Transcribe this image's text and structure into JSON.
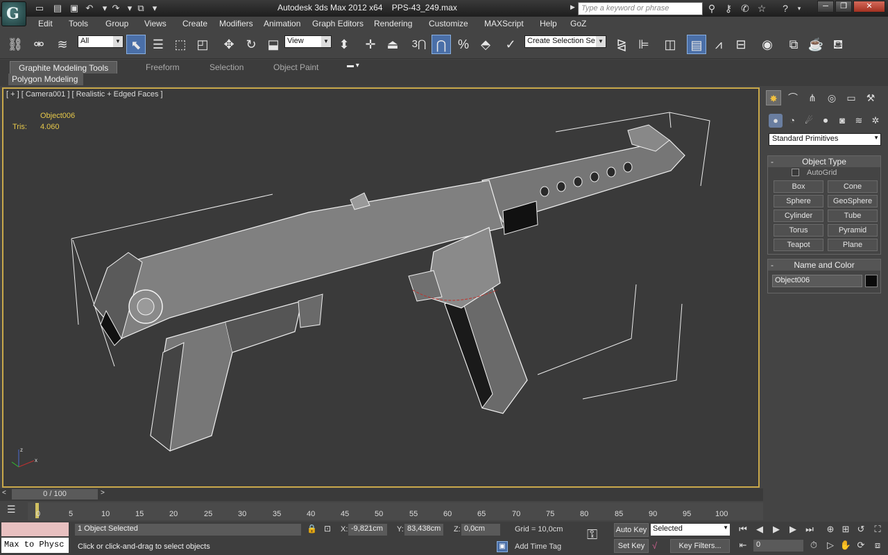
{
  "title": {
    "app": "Autodesk 3ds Max  2012 x64",
    "file": "PPS-43_249.max"
  },
  "search": {
    "placeholder": "Type a keyword or phrase"
  },
  "menu": [
    "Edit",
    "Tools",
    "Group",
    "Views",
    "Create",
    "Modifiers",
    "Animation",
    "Graph Editors",
    "Rendering",
    "Customize",
    "MAXScript",
    "Help",
    "GoZ"
  ],
  "toolbar": {
    "filter": "All",
    "refcoord": "View",
    "selection_set": "Create Selection Se",
    "snap_angle_label": "3"
  },
  "ribbon": {
    "tabs": [
      "Graphite Modeling Tools",
      "Freeform",
      "Selection",
      "Object Paint"
    ],
    "panel": "Polygon Modeling"
  },
  "viewport": {
    "label": "[ + ] [ Camera001 ] [ Realistic + Edged Faces ]",
    "stat_name": "Object006",
    "stat_key": "Tris:",
    "stat_value": "4.060"
  },
  "cmdpanel": {
    "category": "Standard Primitives",
    "object_type": "Object Type",
    "autogrid": "AutoGrid",
    "buttons": [
      "Box",
      "Cone",
      "Sphere",
      "GeoSphere",
      "Cylinder",
      "Tube",
      "Torus",
      "Pyramid",
      "Teapot",
      "Plane"
    ],
    "name_color": "Name and Color",
    "object_name": "Object006",
    "object_color": "#0a0a0a"
  },
  "timeline": {
    "frame": "0 / 100",
    "ticks": [
      "0",
      "5",
      "10",
      "15",
      "20",
      "25",
      "30",
      "35",
      "40",
      "45",
      "50",
      "55",
      "60",
      "65",
      "70",
      "75",
      "80",
      "85",
      "90",
      "95",
      "100"
    ]
  },
  "status": {
    "listener": "Max to Physc",
    "selected": "1 Object Selected",
    "prompt": "Click or click-and-drag to select objects",
    "x_label": "X:",
    "x": "-9,821cm",
    "y_label": "Y:",
    "y": "83,438cm",
    "z_label": "Z:",
    "z": "0,0cm",
    "grid": "Grid = 10,0cm",
    "add_time_tag": "Add Time Tag",
    "auto_key": "Auto Key",
    "set_key": "Set Key",
    "key_mode": "Selected",
    "key_filters": "Key Filters...",
    "current_frame": "0"
  }
}
